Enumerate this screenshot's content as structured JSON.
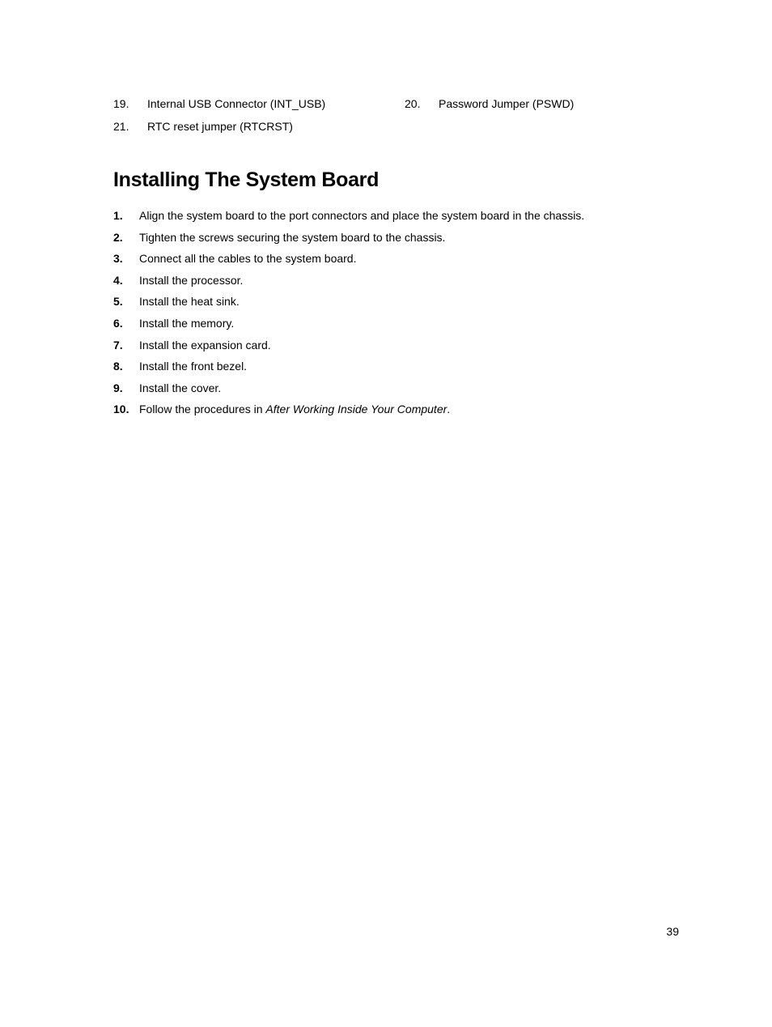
{
  "connectors": [
    {
      "num": "19.",
      "text": "Internal USB Connector (INT_USB)",
      "side": "left"
    },
    {
      "num": "20.",
      "text": "Password Jumper (PSWD)",
      "side": "right"
    },
    {
      "num": "21.",
      "text": "RTC reset jumper (RTCRST)",
      "side": "left"
    }
  ],
  "heading": "Installing The System Board",
  "steps": [
    {
      "num": "1.",
      "text": "Align the system board to the port connectors and place the system board in the chassis."
    },
    {
      "num": "2.",
      "text": "Tighten the screws securing the system board to the chassis."
    },
    {
      "num": "3.",
      "text": "Connect all the cables to the system board."
    },
    {
      "num": "4.",
      "text": "Install the processor."
    },
    {
      "num": "5.",
      "text": "Install the heat sink."
    },
    {
      "num": "6.",
      "text": "Install the memory."
    },
    {
      "num": "7.",
      "text": "Install the expansion card."
    },
    {
      "num": "8.",
      "text": "Install the front bezel."
    },
    {
      "num": "9.",
      "text": "Install the cover."
    },
    {
      "num": "10.",
      "text_prefix": "Follow the procedures in ",
      "text_italic": "After Working Inside Your Computer",
      "text_suffix": "."
    }
  ],
  "page_number": "39"
}
